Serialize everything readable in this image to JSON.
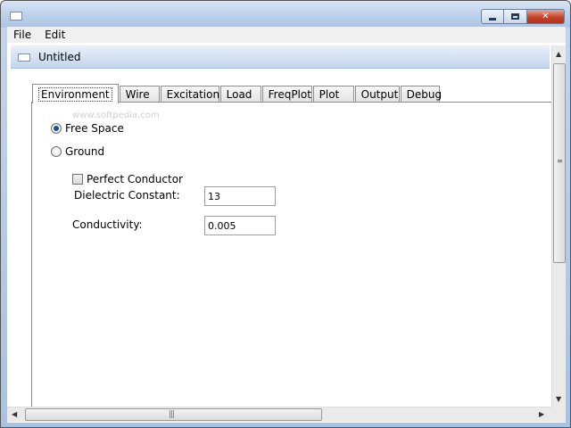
{
  "menubar": {
    "items": [
      "File",
      "Edit"
    ]
  },
  "document": {
    "title": "Untitled"
  },
  "tabs": [
    "Environment",
    "Wire",
    "Excitation",
    "Load",
    "FreqPlot",
    "Plot",
    "Output",
    "Debug"
  ],
  "active_tab": "Environment",
  "watermark": "www.softpedia.com",
  "environment": {
    "free_space_label": "Free Space",
    "free_space_selected": true,
    "ground_label": "Ground",
    "ground_selected": false,
    "perfect_conductor_label": "Perfect Conductor",
    "perfect_conductor_checked": false,
    "dielectric_label": "Dielectric Constant:",
    "dielectric_value": "13",
    "conductivity_label": "Conductivity:",
    "conductivity_value": "0.005"
  },
  "colors": {
    "accent": "#1e4f8c",
    "title_gradient_top": "#d6e4f4",
    "close_red": "#c7432a"
  }
}
